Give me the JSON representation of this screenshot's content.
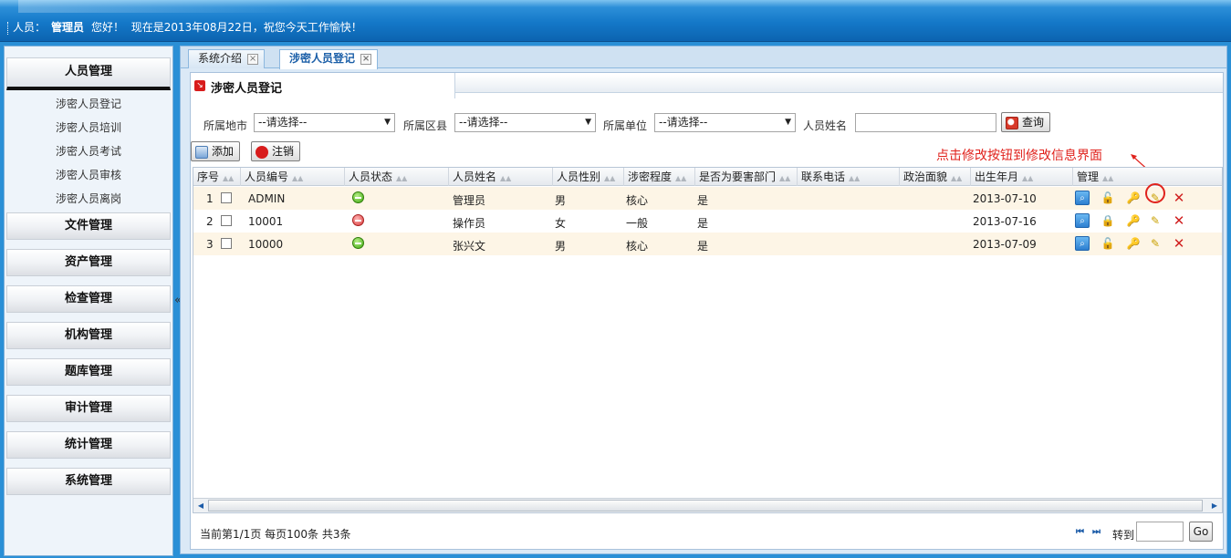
{
  "header": {
    "user_label": "人员：",
    "user_name": "管理员",
    "greeting": "您好！",
    "date_text": "现在是2013年08月22日，祝您今天工作愉快！"
  },
  "sidebar": {
    "active_menu": "人员管理",
    "sub_items": [
      "涉密人员登记",
      "涉密人员培训",
      "涉密人员考试",
      "涉密人员审核",
      "涉密人员离岗"
    ],
    "menus": [
      "文件管理",
      "资产管理",
      "检查管理",
      "机构管理",
      "题库管理",
      "审计管理",
      "统计管理",
      "系统管理"
    ],
    "collapse_symbol": "«"
  },
  "tabs": [
    {
      "label": "系统介绍"
    },
    {
      "label": "涉密人员登记"
    }
  ],
  "panel_title": "涉密人员登记",
  "filters": {
    "city_label": "所属地市",
    "city_value": "--请选择--",
    "county_label": "所属区县",
    "county_value": "--请选择--",
    "unit_label": "所属单位",
    "unit_value": "--请选择--",
    "name_label": "人员姓名",
    "name_value": "",
    "search_label": "查询"
  },
  "toolbar": {
    "add_label": "添加",
    "logout_label": "注销"
  },
  "annotation": "点击修改按钮到修改信息界面",
  "columns": [
    "序号",
    "人员编号",
    "人员状态",
    "人员姓名",
    "人员性别",
    "涉密程度",
    "是否为要害部门",
    "联系电话",
    "政治面貌",
    "出生年月",
    "管理"
  ],
  "rows": [
    {
      "idx": "1",
      "code": "ADMIN",
      "status": "active",
      "name": "管理员",
      "gender": "男",
      "level": "核心",
      "key_dept": "是",
      "phone": "",
      "political": "",
      "birth": "2013-07-10"
    },
    {
      "idx": "2",
      "code": "10001",
      "status": "inactive",
      "name": "操作员",
      "gender": "女",
      "level": "一般",
      "key_dept": "是",
      "phone": "",
      "political": "",
      "birth": "2013-07-16"
    },
    {
      "idx": "3",
      "code": "10000",
      "status": "active",
      "name": "张兴文",
      "gender": "男",
      "level": "核心",
      "key_dept": "是",
      "phone": "",
      "political": "",
      "birth": "2013-07-09"
    }
  ],
  "pager": {
    "summary": "当前第1/1页  每页100条  共3条",
    "goto_label": "转到",
    "go_label": "Go"
  },
  "colors": {
    "header_blue": "#1478c8",
    "annotation_red": "#e0221c",
    "row_highlight": "#fdf5e6"
  }
}
